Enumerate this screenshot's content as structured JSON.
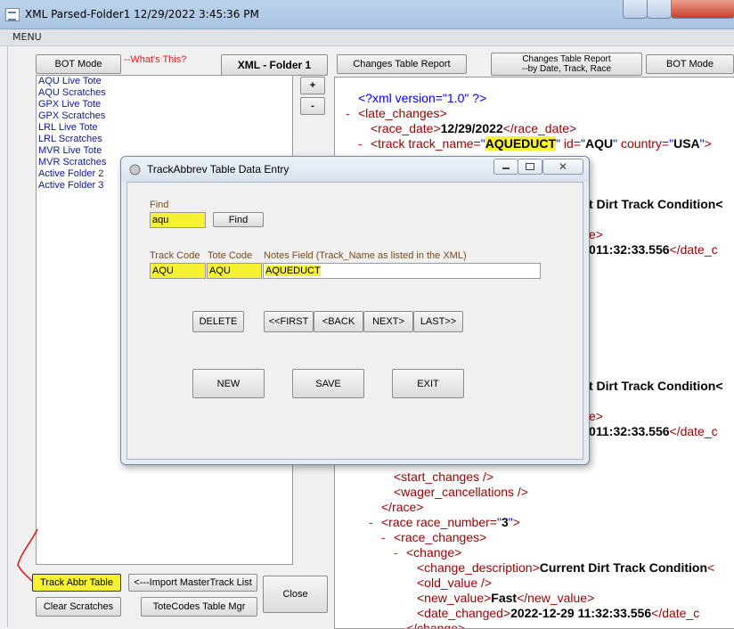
{
  "window": {
    "title": "XML Parsed-Folder1 12/29/2022 3:45:36 PM"
  },
  "menu": {
    "label": "MENU"
  },
  "left": {
    "bot_mode": "BOT Mode",
    "whats_this": "--What's This?",
    "folder_label": "XML - Folder 1",
    "plus": "+",
    "minus": "-",
    "list_items": [
      "AQU Live Tote",
      "AQU Scratches",
      "GPX Live Tote",
      "GPX Scratches",
      "LRL Live Tote",
      "LRL Scratches",
      "MVR Live Tote",
      "MVR Scratches",
      "Active Folder 2",
      "Active Folder 3"
    ],
    "track_abbr_table": "Track Abbr Table",
    "import_master": "<---Import MasterTrack List",
    "close": "Close",
    "clear_scratches": "Clear Scratches",
    "totecodes_mgr": "ToteCodes Table Mgr"
  },
  "right": {
    "changes_report": "Changes Table Report",
    "changes_by_date_l1": "Changes Table Report",
    "changes_by_date_l2": "--by Date, Track, Race",
    "bot_mode": "BOT Mode"
  },
  "xml": {
    "decl": "<?xml version=\"1.0\" ?>",
    "late_changes": "<late_changes>",
    "race_date_open": "<race_date>",
    "race_date_val": "12/29/2022",
    "race_date_close": "</race_date>",
    "track_open": "<track",
    "track_name_attr": " track_name=",
    "track_name_val": "AQUEDUCT",
    "id_attr": " id=",
    "id_val": "AQU",
    "country_attr": " country=",
    "country_val": "USA",
    "gt": ">",
    "quote": "\"",
    "cdtc_1": "t Dirt Track Condition<",
    "ve_1": "e>",
    "dc_1a": " 11:32:33.556",
    "dc_1b": "</date_c",
    "cdtc_2": "t Dirt Track Condition<",
    "ve_2": "e>",
    "dc_2a": " 11:32:33.556",
    "dc_2b": "</date_c",
    "start_changes": "<start_changes />",
    "wager_cancellations": "<wager_cancellations />",
    "race_close": "</race>",
    "race_open": "<race race_number=",
    "race_number_val": "3",
    "race_changes": "<race_changes>",
    "change_open": "<change>",
    "change_desc_open": "<change_description>",
    "change_desc_val": "Current Dirt Track Condition",
    "change_desc_tail": "<",
    "old_value": "<old_value />",
    "new_value_open": "<new_value>",
    "new_value_val": "Fast",
    "new_value_close": "</new_value>",
    "date_changed_open": "<date_changed>",
    "date_changed_val": "2022-12-29 11:32:33.556",
    "date_changed_close": "</date_c",
    "change_close_partial": "</change>",
    "minus_sign": "-",
    "zero_a": "0",
    "zero_b": "0"
  },
  "dialog": {
    "title": "TrackAbbrev Table Data Entry",
    "find_label": "Find",
    "find_value": "aqu",
    "find_button": "Find",
    "track_code_label": "Track Code",
    "tote_code_label": "Tote Code",
    "notes_label": "Notes Field (Track_Name as listed in the XML)",
    "track_code_value": "AQU",
    "tote_code_value": "AQU",
    "notes_value": "AQUEDUCT",
    "delete": "DELETE",
    "first": "<<FIRST",
    "back": "<BACK",
    "next": "NEXT>",
    "last": "LAST>>",
    "new": "NEW",
    "save": "SAVE",
    "exit": "EXIT"
  },
  "colors": {
    "highlight": "#f6f233",
    "xml_tag": "#990000",
    "xml_attr_value": "#0000ff",
    "list_text": "#0a1a8c",
    "red_annotation": "#e02020"
  }
}
